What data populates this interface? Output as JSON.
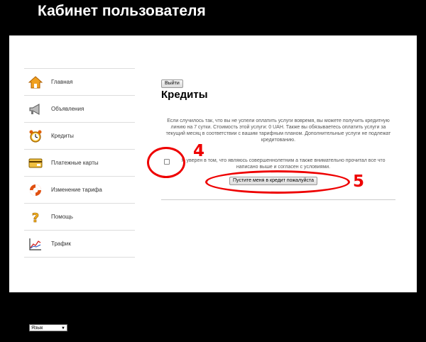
{
  "header": {
    "title": "Кабинет пользователя"
  },
  "sidebar": {
    "items": [
      {
        "label": "Главная",
        "icon": "home-icon"
      },
      {
        "label": "Объявления",
        "icon": "megaphone-icon"
      },
      {
        "label": "Кредиты",
        "icon": "alarm-clock-icon"
      },
      {
        "label": "Платежные карты",
        "icon": "credit-card-icon"
      },
      {
        "label": "Изменение тарифа",
        "icon": "lifebuoy-icon"
      },
      {
        "label": "Помощь",
        "icon": "question-icon"
      },
      {
        "label": "Трафик",
        "icon": "chart-icon"
      }
    ]
  },
  "main": {
    "logout_label": "Выйти",
    "heading": "Кредиты",
    "info_text": "Если случилось так, что вы не успели оплатить услуги вовремя, вы можете получить кредитную линию на 7 сутки. Стоимость этой услуги: 0 UAH. Также вы обязываетесь оплатить услуги за текущий месяц в соответствии с вашим тарифным планом. Дополнительные услуги не подлежат кредитованию.",
    "agree_text": "Я уверен в том, что являюсь совершеннолетним а также внимательно прочитал все что написано выше и согласен с условиями.",
    "submit_label": "Пустите меня в кредит пожалуйста"
  },
  "annotations": {
    "checkbox_number": "4",
    "button_number": "5",
    "color": "#e00000"
  },
  "footer": {
    "language_label": "Язык"
  }
}
